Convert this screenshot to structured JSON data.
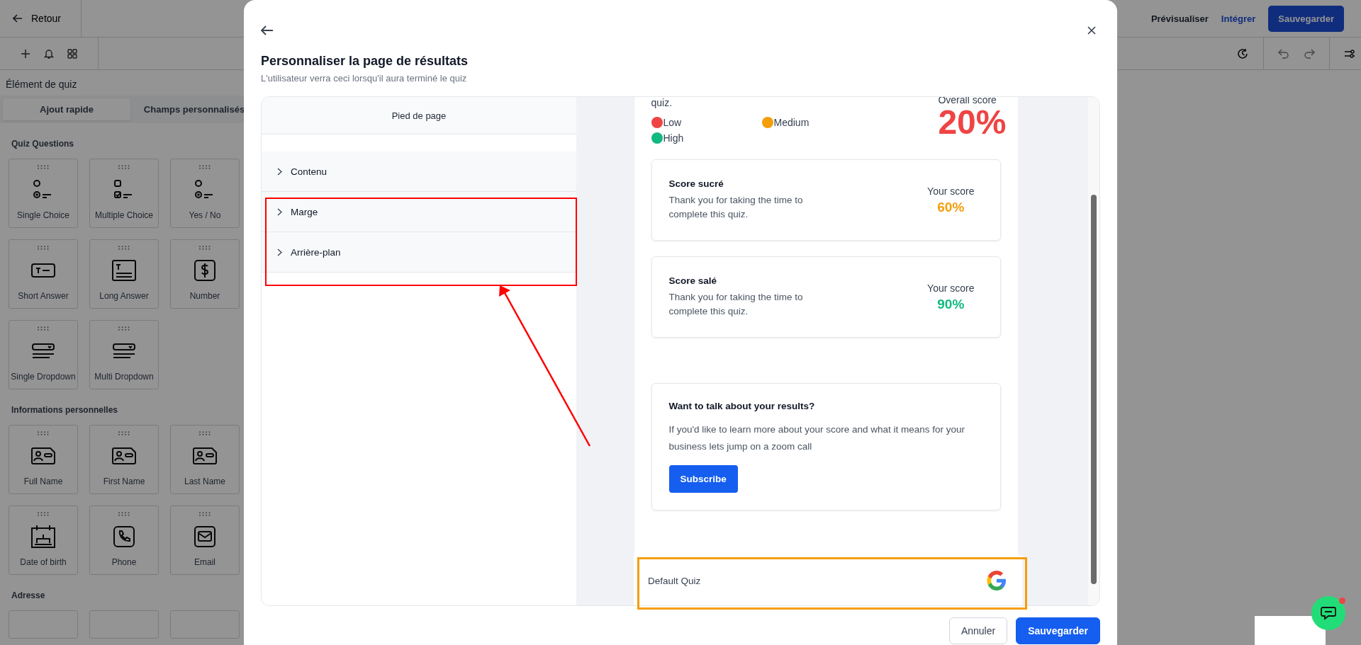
{
  "topbar": {
    "back": "Retour",
    "actions": [
      {
        "label": "Prévisualiser",
        "kind": "text"
      },
      {
        "label": "Intégrer",
        "kind": "link"
      },
      {
        "label": "Sauvegarder",
        "kind": "primary"
      }
    ]
  },
  "sidebar": {
    "title": "Élément de quiz",
    "tabs": [
      {
        "label": "Ajout rapide",
        "selected": true
      },
      {
        "label": "Champs personnalisés",
        "selected": false
      }
    ],
    "sections": [
      {
        "title": "Quiz Questions",
        "items": [
          {
            "label": "Single Choice",
            "kind": "single"
          },
          {
            "label": "Multiple Choice",
            "kind": "multiple"
          },
          {
            "label": "Yes / No",
            "kind": "single"
          },
          {
            "label": "Short Answer",
            "kind": "short"
          },
          {
            "label": "Long Answer",
            "kind": "long"
          },
          {
            "label": "Number",
            "kind": "number"
          },
          {
            "label": "Single Dropdown",
            "kind": "dropdown"
          },
          {
            "label": "Multi Dropdown",
            "kind": "dropdown"
          }
        ]
      },
      {
        "title": "Informations personnelles",
        "items": [
          {
            "label": "Full Name",
            "kind": "idcard"
          },
          {
            "label": "First Name",
            "kind": "idcard"
          },
          {
            "label": "Last Name",
            "kind": "idcard"
          },
          {
            "label": "Date of birth",
            "kind": "cake"
          },
          {
            "label": "Phone",
            "kind": "phone"
          },
          {
            "label": "Email",
            "kind": "mail"
          }
        ]
      },
      {
        "title": "Adresse"
      }
    ]
  },
  "modal": {
    "title": "Personnaliser la page de résultats",
    "subtitle": "L'utilisateur verra ceci lorsqu'il aura terminé le quiz",
    "panel_header": "Pied de page",
    "sections": [
      {
        "label": "Contenu",
        "expanded": false
      },
      {
        "label": "Marge",
        "expanded": false
      },
      {
        "label": "Arrière-plan",
        "expanded": false
      }
    ],
    "preview": {
      "intro": "quiz.",
      "legend": [
        {
          "label": "Low",
          "color": "#ef4444"
        },
        {
          "label": "Medium",
          "color": "#f59e0b"
        },
        {
          "label": "High",
          "color": "#10b981"
        }
      ],
      "overall": {
        "label": "Overall score",
        "value": "20%",
        "color": "#ef4444"
      },
      "scores": [
        {
          "title": "Score sucré",
          "text": "Thank you for taking the time to complete this quiz.",
          "label": "Your score",
          "value": "60%",
          "color": "#f59e0b"
        },
        {
          "title": "Score salé",
          "text": "Thank you for taking the time to complete this quiz.",
          "label": "Your score",
          "value": "90%",
          "color": "#10b981"
        }
      ],
      "cta": {
        "title": "Want to talk about your results?",
        "text": "If you'd like to learn more about your score and what it means for your business lets jump on a zoom call",
        "button": "Subscribe"
      },
      "footer": {
        "text": "Default Quiz"
      }
    },
    "buttons": [
      {
        "label": "Annuler",
        "kind": "secondary"
      },
      {
        "label": "Sauvegarder",
        "kind": "primary"
      }
    ]
  }
}
